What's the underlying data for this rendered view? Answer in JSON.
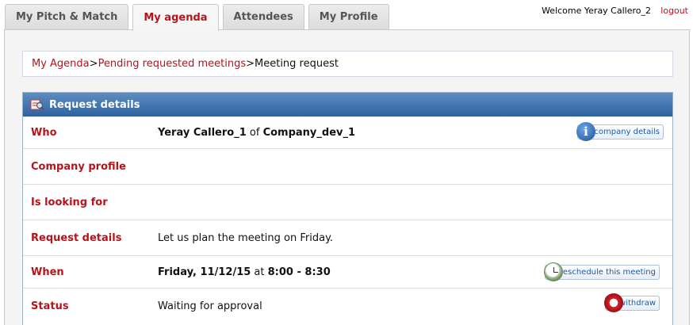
{
  "tabs": [
    {
      "label": "My Pitch & Match",
      "active": false
    },
    {
      "label": "My agenda",
      "active": true
    },
    {
      "label": "Attendees",
      "active": false
    },
    {
      "label": "My Profile",
      "active": false
    }
  ],
  "header": {
    "welcome": "Welcome Yeray Callero_2",
    "logout": "logout"
  },
  "breadcrumb": {
    "items": [
      "My Agenda",
      "Pending requested meetings"
    ],
    "separators": [
      ">",
      "> "
    ],
    "current": "Meeting request"
  },
  "request": {
    "title": "Request details",
    "header_icon": "magnifier-document-icon",
    "rows": {
      "who": {
        "label": "Who",
        "person": "Yeray Callero_1",
        "of": " of ",
        "company": "Company_dev_1",
        "action": "company details"
      },
      "company_profile": {
        "label": "Company profile"
      },
      "looking_for": {
        "label": "Is looking for"
      },
      "details": {
        "label": "Request details",
        "value": "Let us plan the meeting on Friday."
      },
      "when": {
        "label": "When",
        "date": "Friday, 11/12/15",
        "at": " at ",
        "time": "8:00 - 8:30",
        "action": "reschedule this meeting"
      },
      "status": {
        "label": "Status",
        "value": "Waiting for approval",
        "action": "withdraw"
      }
    }
  },
  "colors": {
    "accent_red": "#b5141b",
    "header_blue": "#2f639f",
    "link_blue": "#1c5aa6"
  }
}
